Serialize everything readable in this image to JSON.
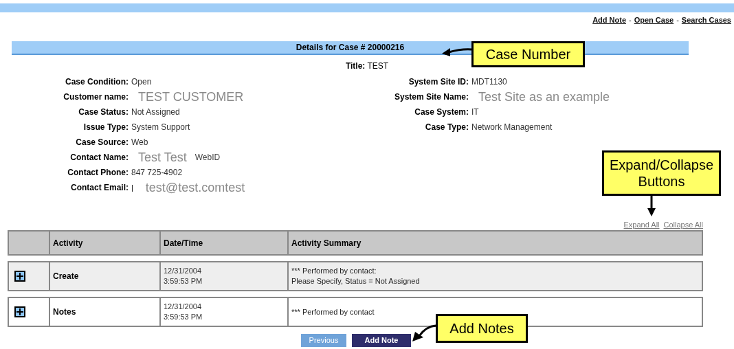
{
  "top_links": [
    {
      "label": "Add Note",
      "separator": "-"
    },
    {
      "label": "Open Case",
      "separator": "-"
    },
    {
      "label": "Search Cases"
    }
  ],
  "header": "Details for Case # 20000216",
  "title": "**Title:** TEST",
  "fields_left": [
    {
      "label": "Case Condition:",
      "value": "Open",
      "kind": "plain"
    },
    {
      "label": "Customer name:",
      "value": "TEST CUSTOMER",
      "kind": "large"
    },
    {
      "label": "Case Status:",
      "value": "Not Assigned",
      "kind": "plain"
    },
    {
      "label": "Issue Type:",
      "value": "System Support",
      "kind": "plain"
    },
    {
      "label": "Case Source:",
      "value": "Web",
      "kind": "plain"
    },
    {
      "label": "Contact Name:",
      "value": "Test Test",
      "kind": "large",
      "extra": "WebID"
    },
    {
      "label": "Contact Phone:",
      "value": "847 725-4902",
      "kind": "plain"
    },
    {
      "label": "Contact Email:",
      "prefix": "|",
      "value": "test@test.comtest",
      "kind": "large"
    }
  ],
  "fields_right": [
    {
      "label": "System Site ID:",
      "value": "MDT1130",
      "kind": "plain"
    },
    {
      "label": "System Site Name:",
      "value": "Test Site as an example",
      "kind": "large"
    },
    {
      "label": "Case System:",
      "value": "IT",
      "kind": "plain"
    },
    {
      "label": "Case Type:",
      "value": "Network Management",
      "kind": "plain"
    }
  ],
  "expand_links": [
    "Expand All",
    "Collapse All"
  ],
  "table": {
    "columns": [
      "Activity",
      "Date/Time",
      "Activity Summary"
    ],
    "rows": [
      {
        "expanded": false,
        "activity": "Create",
        "date": "12/31/2004",
        "time": "3:59:53 PM",
        "summary": [
          "*** Performed by contact:",
          "Please Specify, Status = Not Assigned"
        ]
      },
      {
        "expanded": false,
        "activity": "Notes",
        "date": "12/31/2004",
        "time": "3:59:53 PM",
        "summary": [
          "*** Performed by contact"
        ]
      }
    ]
  },
  "buttons": [
    {
      "label": "Previous",
      "kind": "secondary"
    },
    {
      "label": "Add Note",
      "kind": "primary"
    }
  ],
  "callouts": [
    {
      "label": "Case Number",
      "kind": "case"
    },
    {
      "label": "Expand/Collapse Buttons",
      "kind": "expand"
    },
    {
      "label": "Add Notes",
      "kind": "add"
    }
  ]
}
